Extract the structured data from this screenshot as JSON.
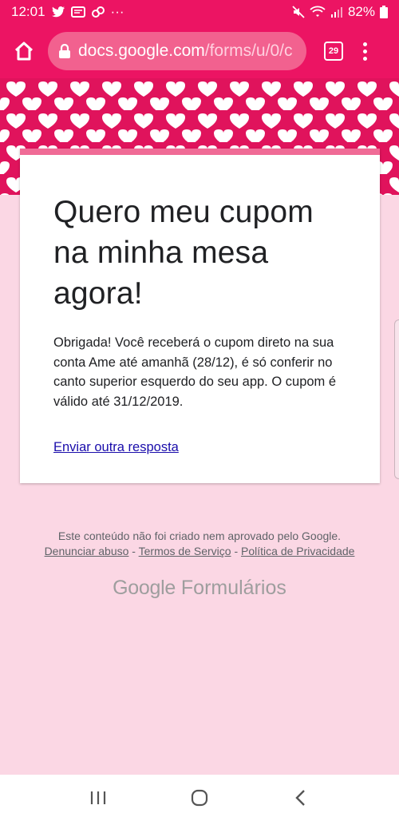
{
  "status_bar": {
    "time": "12:01",
    "overflow": "···",
    "battery": "82%"
  },
  "browser": {
    "url_domain": "docs.google.com",
    "url_path": "/forms/u/0/c",
    "tab_count": "29"
  },
  "form": {
    "title": "Quero meu cupom na minha mesa agora!",
    "confirmation": "Obrigada! Você receberá o cupom direto na sua conta Ame até amanhã (28/12), é só conferir no canto superior esquerdo do seu app. O cupom é válido até 31/12/2019.",
    "resubmit_link": "Enviar outra resposta"
  },
  "footer": {
    "disclaimer": "Este conteúdo não foi criado nem aprovado pelo Google.",
    "report_abuse": "Denunciar abuso",
    "separator": " - ",
    "terms": "Termos de Serviço",
    "privacy": "Política de Privacidade",
    "brand_google": "Google",
    "brand_product": "Formulários"
  },
  "colors": {
    "accent": "#ec1463",
    "card_accent": "#f06b96",
    "background": "#fbd7e4"
  }
}
